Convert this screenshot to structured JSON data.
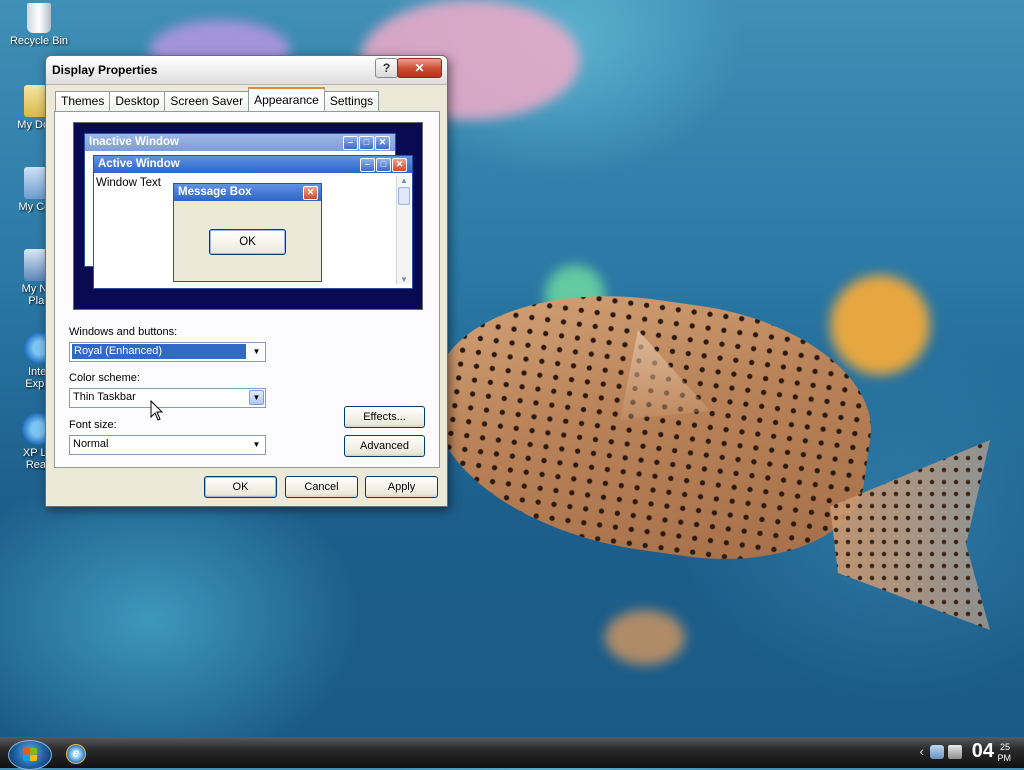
{
  "desktop": {
    "icons": [
      {
        "label": "Recycle Bin"
      },
      {
        "label": "My Docu"
      },
      {
        "label": "My Com"
      },
      {
        "label": "My Net"
      },
      {
        "label": "Plac"
      },
      {
        "label": "Inter"
      },
      {
        "label": "Explo"
      },
      {
        "label": "XP Lig"
      },
      {
        "label": "Read"
      }
    ]
  },
  "dialog": {
    "title": "Display Properties",
    "help_glyph": "?",
    "close_glyph": "✕",
    "tabs": [
      "Themes",
      "Desktop",
      "Screen Saver",
      "Appearance",
      "Settings"
    ],
    "active_tab": "Appearance",
    "preview": {
      "inactive_title": "Inactive Window",
      "active_title": "Active Window",
      "window_text": "Window Text",
      "message_title": "Message Box",
      "ok": "OK"
    },
    "windows_buttons_label": "Windows and buttons:",
    "windows_buttons_value": "Royal (Enhanced)",
    "color_scheme_label": "Color scheme:",
    "color_scheme_value": "Thin Taskbar",
    "font_size_label": "Font size:",
    "font_size_value": "Normal",
    "effects_btn": "Effects...",
    "advanced_btn": "Advanced",
    "ok_btn": "OK",
    "cancel_btn": "Cancel",
    "apply_btn": "Apply"
  },
  "taskbar": {
    "clock_hour": "04",
    "clock_min": "25",
    "clock_ampm": "PM",
    "chevron": "‹"
  },
  "colors": {
    "accent": "#316ac5",
    "title_active": "#3d78d8",
    "preview_bg": "#0a0a52"
  }
}
